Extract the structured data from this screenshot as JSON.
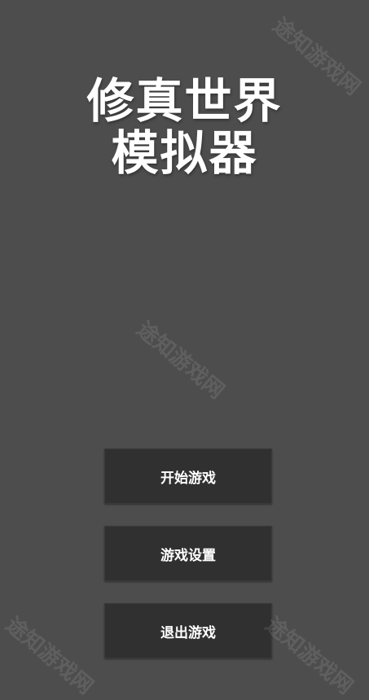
{
  "title": {
    "line1": "修真世界",
    "line2": "模拟器"
  },
  "menu": {
    "start_label": "开始游戏",
    "settings_label": "游戏设置",
    "exit_label": "退出游戏"
  },
  "watermark": {
    "text": "途知游戏网"
  },
  "colors": {
    "background": "#4d4d4d",
    "button_bg": "#303030",
    "text": "#ffffff"
  }
}
